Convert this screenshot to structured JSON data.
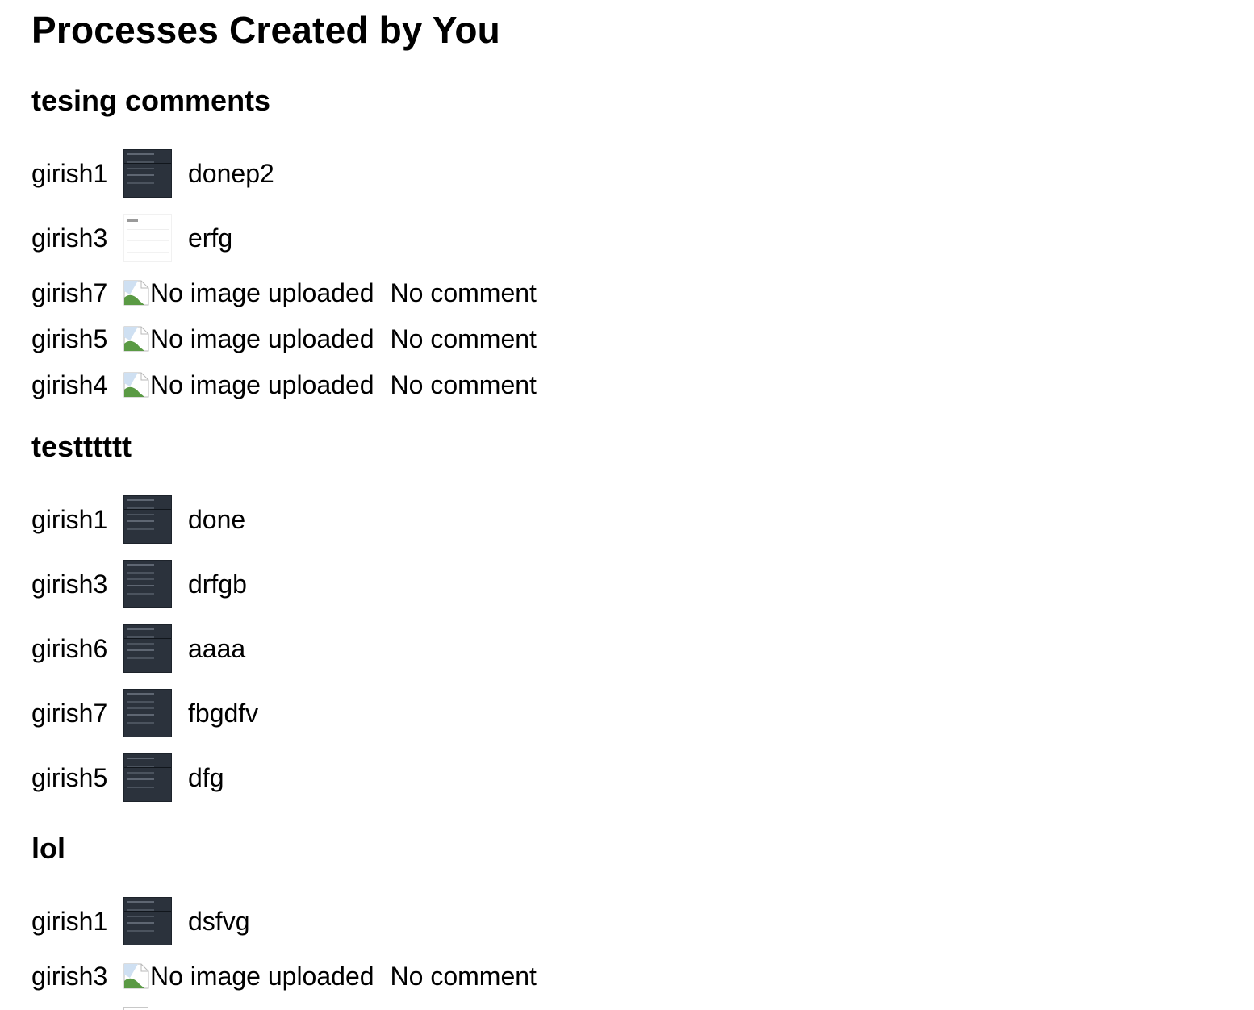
{
  "page": {
    "title": "Processes Created by You"
  },
  "sections": [
    {
      "title": "tesing comments",
      "rows": [
        {
          "user": "girish1",
          "image": "thumbnail-dark",
          "comment": "donep2"
        },
        {
          "user": "girish3",
          "image": "thumbnail-light",
          "comment": "erfg"
        },
        {
          "user": "girish7",
          "image_alt": "No image uploaded",
          "comment": "No comment"
        },
        {
          "user": "girish5",
          "image_alt": "No image uploaded",
          "comment": "No comment"
        },
        {
          "user": "girish4",
          "image_alt": "No image uploaded",
          "comment": "No comment"
        }
      ]
    },
    {
      "title": "testttttt",
      "rows": [
        {
          "user": "girish1",
          "image": "thumbnail-dark",
          "comment": "done"
        },
        {
          "user": "girish3",
          "image": "thumbnail-dark",
          "comment": "drfgb"
        },
        {
          "user": "girish6",
          "image": "thumbnail-dark",
          "comment": "aaaa"
        },
        {
          "user": "girish7",
          "image": "thumbnail-dark",
          "comment": "fbgdfv"
        },
        {
          "user": "girish5",
          "image": "thumbnail-dark",
          "comment": "dfg"
        }
      ]
    },
    {
      "title": "lol",
      "rows": [
        {
          "user": "girish1",
          "image": "thumbnail-dark",
          "comment": "dsfvg"
        },
        {
          "user": "girish3",
          "image_alt": "No image uploaded",
          "comment": "No comment"
        }
      ]
    }
  ],
  "icons": {
    "broken_image": "broken-image-icon"
  }
}
